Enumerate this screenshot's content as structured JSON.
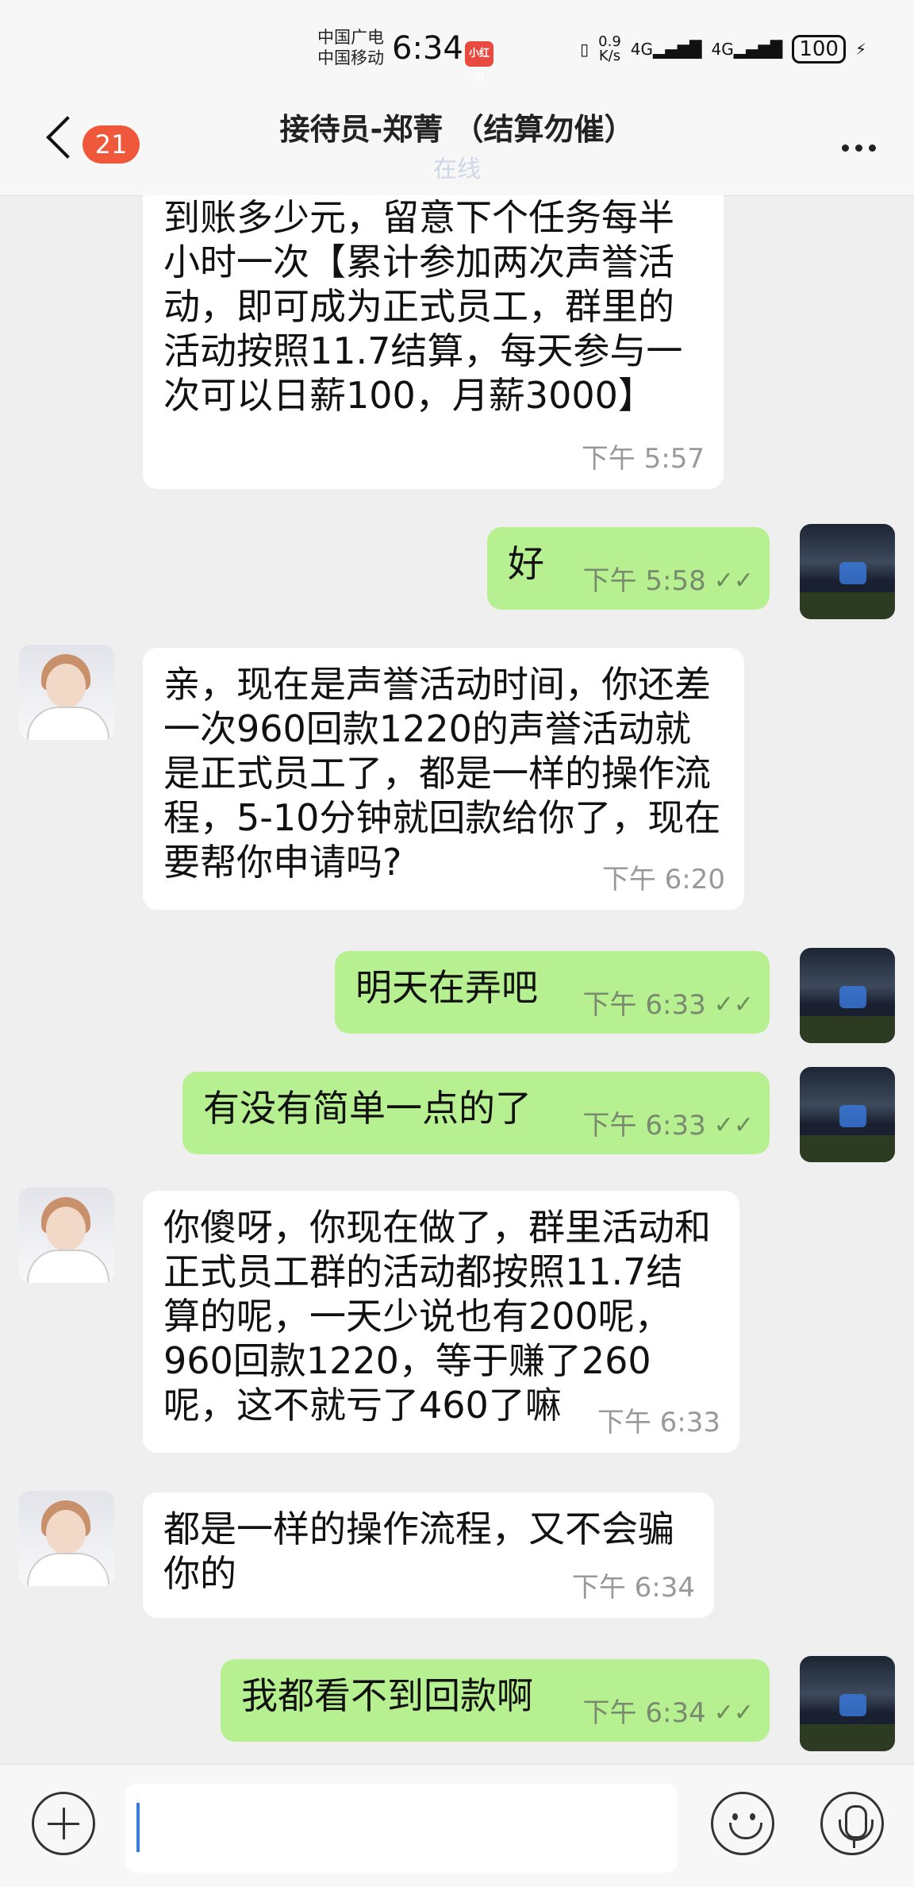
{
  "status_bar": {
    "carrier1": "中国广电",
    "carrier2": "中国移动",
    "time": "6:34",
    "app_badge": "小红书",
    "net_speed_value": "0.9",
    "net_speed_unit": "K/s",
    "signal1": "4G",
    "signal2": "4G",
    "battery": "100"
  },
  "header": {
    "unread_count": "21",
    "title": "接待员-郑菁 （结算勿催）",
    "status": "在线"
  },
  "messages": [
    {
      "dir": "in",
      "text": "到账多少元，留意下个任务每半小时一次【累计参加两次声誉活动，即可成为正式员工，群里的活动按照11.7结算，每天参与一次可以日薪100，月薪3000】",
      "time": "下午 5:57"
    },
    {
      "dir": "out",
      "text": "好",
      "time": "下午 5:58"
    },
    {
      "dir": "in",
      "text": "亲，现在是声誉活动时间，你还差一次960回款1220的声誉活动就是正式员工了，都是一样的操作流程，5-10分钟就回款给你了，现在要帮你申请吗?",
      "time": "下午 6:20"
    },
    {
      "dir": "out",
      "text": "明天在弄吧",
      "time": "下午 6:33"
    },
    {
      "dir": "out",
      "text": "有没有简单一点的了",
      "time": "下午 6:33"
    },
    {
      "dir": "in",
      "text": "你傻呀，你现在做了，群里活动和正式员工群的活动都按照11.7结算的呢，一天少说也有200呢，960回款1220，等于赚了260呢，这不就亏了460了嘛",
      "time": "下午 6:33"
    },
    {
      "dir": "in",
      "text": "都是一样的操作流程，又不会骗你的",
      "time": "下午 6:34"
    },
    {
      "dir": "out",
      "text": "我都看不到回款啊",
      "time": "下午 6:34"
    }
  ],
  "read_mark": "✓✓",
  "input": {
    "placeholder": ""
  },
  "icons": {
    "add": "plus-circle-icon",
    "emoji": "smile-icon",
    "voice": "microphone-icon"
  },
  "colors": {
    "outgoing_bubble": "#b6f090",
    "incoming_bubble": "#ffffff",
    "unread_badge": "#f0583b"
  }
}
